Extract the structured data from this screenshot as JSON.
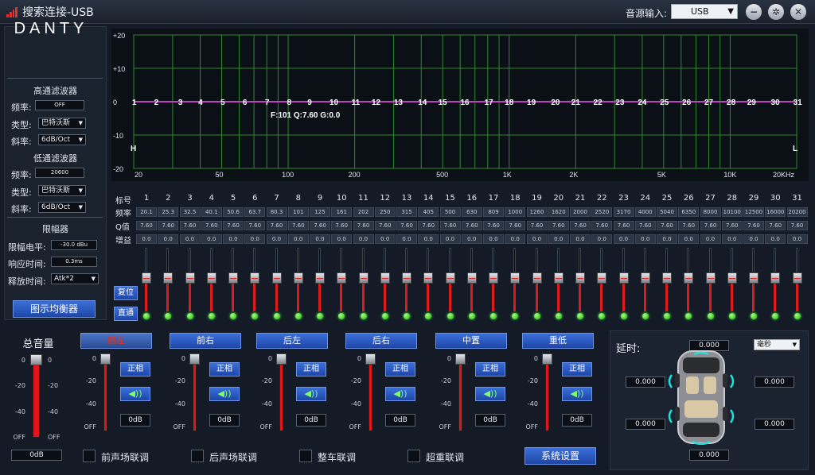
{
  "window": {
    "title": "搜索连接-USB",
    "source_label": "音源输入:",
    "source_value": "USB"
  },
  "brand": {
    "logo": "DANTY"
  },
  "highpass": {
    "title": "高通滤波器",
    "freq_label": "频率:",
    "freq_value": "OFF",
    "type_label": "类型:",
    "type_value": "巴特沃斯",
    "slope_label": "斜率:",
    "slope_value": "6dB/Oct"
  },
  "lowpass": {
    "title": "低通滤波器",
    "freq_label": "频率:",
    "freq_value": "20600",
    "type_label": "类型:",
    "type_value": "巴特沃斯",
    "slope_label": "斜率:",
    "slope_value": "6dB/Oct"
  },
  "limiter": {
    "title": "限幅器",
    "level_label": "限幅电平:",
    "level_value": "-30.0 dBu",
    "attack_label": "响应时间:",
    "attack_value": "0.3ms",
    "release_label": "释放时间:",
    "release_value": "Atk*2"
  },
  "geq_button": "图示均衡器",
  "graph": {
    "y_ticks": [
      "+20",
      "+10",
      "0",
      "-10",
      "-20"
    ],
    "x_ticks": [
      "20",
      "50",
      "100",
      "200",
      "500",
      "1K",
      "2K",
      "5K",
      "10K",
      "20KHz"
    ],
    "info": "F:101 Q:7.60 G:0.0",
    "hp_marker": "H",
    "lp_marker": "L",
    "curve_color": "#c040c0"
  },
  "eq": {
    "row_labels": {
      "index": "标号",
      "freq": "频率",
      "q": "Q值",
      "gain": "增益"
    },
    "bands": [
      "1",
      "2",
      "3",
      "4",
      "5",
      "6",
      "7",
      "8",
      "9",
      "10",
      "11",
      "12",
      "13",
      "14",
      "15",
      "16",
      "17",
      "18",
      "19",
      "20",
      "21",
      "22",
      "23",
      "24",
      "25",
      "26",
      "27",
      "28",
      "29",
      "30",
      "31"
    ],
    "freqs": [
      "20.1",
      "25.3",
      "32.5",
      "40.1",
      "50.6",
      "63.7",
      "80.3",
      "101",
      "125",
      "161",
      "202",
      "250",
      "315",
      "405",
      "500",
      "630",
      "809",
      "1000",
      "1260",
      "1620",
      "2000",
      "2520",
      "3170",
      "4000",
      "5040",
      "6350",
      "8000",
      "10100",
      "12500",
      "16000",
      "20200"
    ],
    "q": [
      "7.60",
      "7.60",
      "7.60",
      "7.60",
      "7.60",
      "7.60",
      "7.60",
      "7.60",
      "7.60",
      "7.60",
      "7.60",
      "7.60",
      "7.60",
      "7.60",
      "7.60",
      "7.60",
      "7.60",
      "7.60",
      "7.60",
      "7.60",
      "7.60",
      "7.60",
      "7.60",
      "7.60",
      "7.60",
      "7.60",
      "7.60",
      "7.60",
      "7.60",
      "7.60",
      "7.60"
    ],
    "gain": [
      "0.0",
      "0.0",
      "0.0",
      "0.0",
      "0.0",
      "0.0",
      "0.0",
      "0.0",
      "0.0",
      "0.0",
      "0.0",
      "0.0",
      "0.0",
      "0.0",
      "0.0",
      "0.0",
      "0.0",
      "0.0",
      "0.0",
      "0.0",
      "0.0",
      "0.0",
      "0.0",
      "0.0",
      "0.0",
      "0.0",
      "0.0",
      "0.0",
      "0.0",
      "0.0",
      "0.0"
    ],
    "reset_label": "复位",
    "bypass_label": "直通"
  },
  "master": {
    "title": "总音量",
    "scale": [
      "0",
      "-20",
      "-40",
      "OFF"
    ],
    "value": "0dB"
  },
  "channels": [
    {
      "name": "前左",
      "phase": "正相",
      "value": "0dB"
    },
    {
      "name": "前右",
      "phase": "正相",
      "value": "0dB"
    },
    {
      "name": "后左",
      "phase": "正相",
      "value": "0dB"
    },
    {
      "name": "后右",
      "phase": "正相",
      "value": "0dB"
    },
    {
      "name": "中置",
      "phase": "正相",
      "value": "0dB"
    },
    {
      "name": "重低",
      "phase": "正相",
      "value": "0dB"
    }
  ],
  "channel_scale": [
    "0",
    "-20",
    "-40",
    "OFF"
  ],
  "links": [
    "前声场联调",
    "后声场联调",
    "整车联调",
    "超重联调"
  ],
  "system_button": "系统设置",
  "delay": {
    "title": "延时:",
    "unit": "毫秒",
    "top": "0.000",
    "front_left": "0.000",
    "front_right": "0.000",
    "rear_left": "0.000",
    "rear_right": "0.000",
    "bottom": "0.000"
  }
}
